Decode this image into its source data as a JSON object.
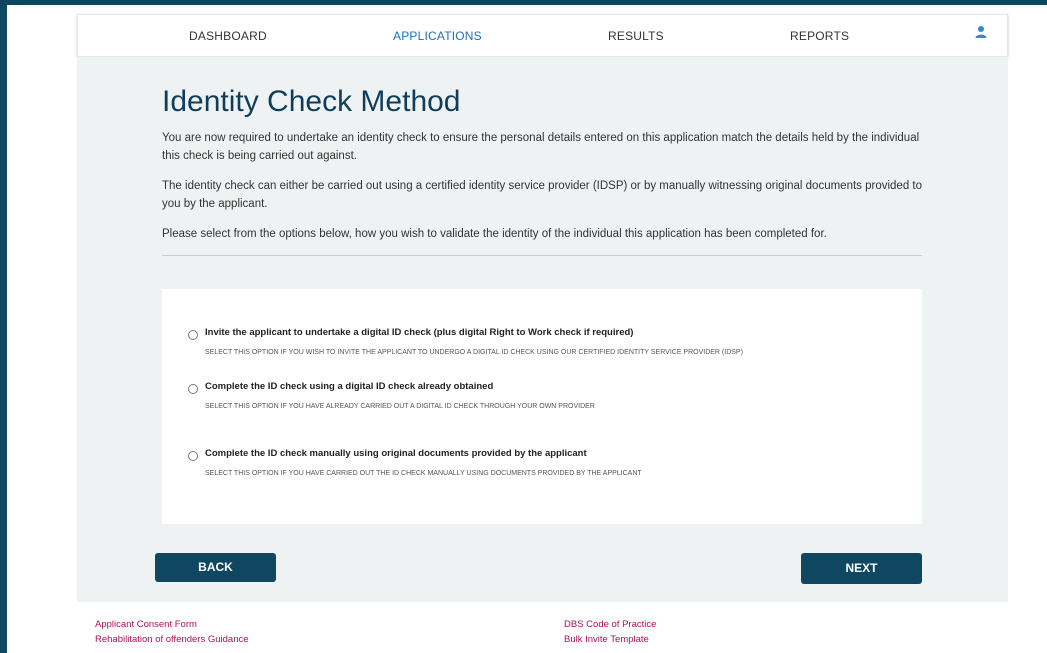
{
  "nav": {
    "items": [
      {
        "label": "DASHBOARD",
        "active": false
      },
      {
        "label": "APPLICATIONS",
        "active": true
      },
      {
        "label": "RESULTS",
        "active": false
      },
      {
        "label": "REPORTS",
        "active": false
      }
    ],
    "user_icon": "user-icon"
  },
  "page": {
    "title": "Identity Check Method",
    "para1": "You are now required to undertake an identity check to ensure the personal details entered on this application match the details held by the individual this check is being carried out against.",
    "para2": "The identity check can either be carried out using a certified identity service provider (IDSP) or by manually witnessing original documents provided to you by the applicant.",
    "para3": "Please select from the options below, how you wish to validate the identity of the individual this application has been completed for."
  },
  "options": [
    {
      "label": "Invite the applicant to undertake a digital ID check (plus digital Right to Work check if required)",
      "help": "SELECT THIS OPTION IF YOU WISH TO INVITE THE APPLICANT TO UNDERGO A DIGITAL ID CHECK USING OUR CERTIFIED IDENTITY SERVICE PROVIDER (IDSP)"
    },
    {
      "label": "Complete the ID check using a digital ID check already obtained",
      "help": "SELECT THIS OPTION IF YOU HAVE ALREADY CARRIED OUT A DIGITAL ID CHECK THROUGH YOUR OWN PROVIDER"
    },
    {
      "label": "Complete the ID check manually using original documents provided by the applicant",
      "help": "SELECT THIS OPTION IF YOU HAVE CARRIED OUT THE ID CHECK MANUALLY USING DOCUMENTS PROVIDED BY THE APPLICANT"
    }
  ],
  "buttons": {
    "back": "BACK",
    "next": "NEXT"
  },
  "footer": {
    "left": [
      "Applicant Consent Form",
      "Rehabilitation of offenders Guidance"
    ],
    "right": [
      "DBS Code of Practice",
      "Bulk Invite Template"
    ]
  },
  "colors": {
    "brand": "#0f4761",
    "accent": "#1f6fb8",
    "link": "#b0105a"
  }
}
